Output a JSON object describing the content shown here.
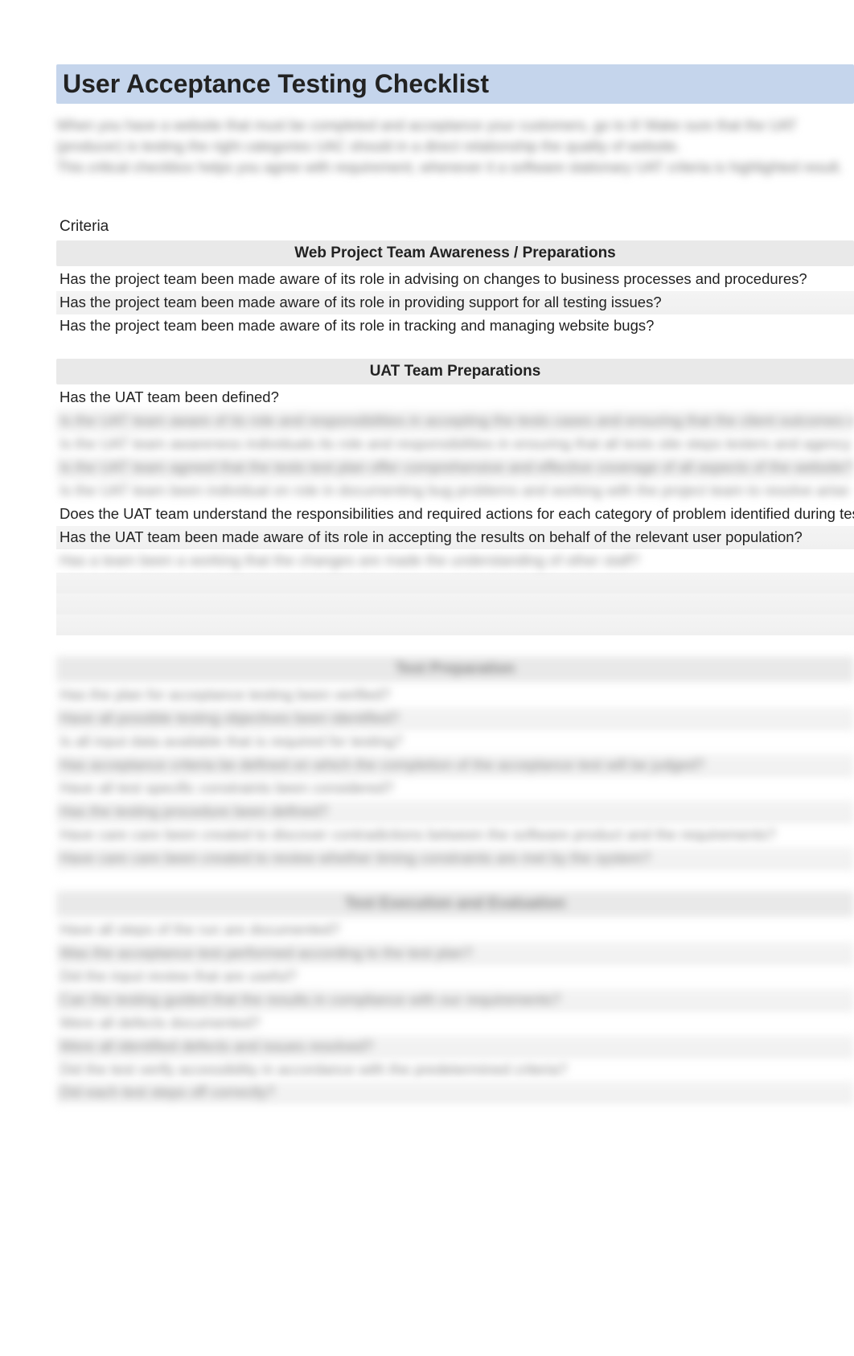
{
  "title": "User Acceptance Testing Checklist",
  "intro_lines": [
    "When you have a website that must be completed and acceptance your customers, go to it! Make sure that the UAT (producer) is testing the right categories UAC should in a direct relationship the quality of website.",
    "This critical checkbox helps you agree with requirement, whenever it a software stationary UAT criteria is highlighted result."
  ],
  "criteria_label": "Criteria",
  "sections": [
    {
      "heading": "Web Project Team Awareness / Preparations",
      "rows": [
        {
          "text": "Has the project team been made aware of its role in advising on changes to business processes and procedures?",
          "blur": false
        },
        {
          "text": "Has the project team been made aware of its role in providing support for all testing issues?",
          "blur": false
        },
        {
          "text": "Has the project team been made aware of its role in tracking and managing website bugs?",
          "blur": false
        }
      ]
    },
    {
      "heading": "UAT Team Preparations",
      "rows": [
        {
          "text": "Has the UAT team been defined?",
          "blur": false
        },
        {
          "text": "Is the UAT team aware of its role and responsibilities in accepting the tests cases and ensuring that the client outcomes within site agreement?",
          "blur": true
        },
        {
          "text": "Is the UAT team awareness individuals its role and responsibilities in ensuring that all tests site steps testers and agency related abilities?",
          "blur": true
        },
        {
          "text": "Is the UAT team agreed that the tests test plan offer comprehensive and effective coverage of all aspects of the website?",
          "blur": true
        },
        {
          "text": "Is the UAT team been individual on role in documenting bug problems and working with the project team to resolve arise during testing?",
          "blur": true
        },
        {
          "text": "Does the UAT team understand the responsibilities and required actions for each category of problem identified during testing?",
          "blur": false
        },
        {
          "text": "Has the UAT team been made aware of its role in accepting the results on behalf of the relevant user population?",
          "blur": false
        },
        {
          "text": "Has a team been a working that the changes are made the understanding of other staff?",
          "blur": true
        },
        {
          "text": " ",
          "blur": false
        },
        {
          "text": " ",
          "blur": false
        },
        {
          "text": " ",
          "blur": false
        }
      ]
    },
    {
      "heading": "Test Preparation",
      "blur_heading": true,
      "rows": [
        {
          "text": "Has the plan for acceptance testing been verified?",
          "blur": true
        },
        {
          "text": "Have all possible testing objectives been identified?",
          "blur": true
        },
        {
          "text": "Is all input data available that is required for testing?",
          "blur": true
        },
        {
          "text": "Has acceptance criteria be defined on which the completion of the acceptance test will be judged?",
          "blur": true
        },
        {
          "text": "Have all test specific constraints been considered?",
          "blur": true
        },
        {
          "text": "Has the testing procedure been defined?",
          "blur": true
        },
        {
          "text": "Have care care been created to discover contradictions between the software product and the requirements?",
          "blur": true
        },
        {
          "text": "Have care care been created to review whether timing constraints are met by the system?",
          "blur": true
        }
      ]
    },
    {
      "heading": "Test Execution and Evaluation",
      "blur_heading": true,
      "rows": [
        {
          "text": "Have all steps of the run are documented?",
          "blur": true
        },
        {
          "text": "Was the acceptance test performed according to the test plan?",
          "blur": true
        },
        {
          "text": "Did the input review that are useful?",
          "blur": true
        },
        {
          "text": "Can the testing guided that the results in compliance with our requirements?",
          "blur": true
        },
        {
          "text": "Were all defects documented?",
          "blur": true
        },
        {
          "text": "Were all identified defects and issues resolved?",
          "blur": true
        },
        {
          "text": "Did the test verify accessibility in accordance with the predetermined criteria?",
          "blur": true
        },
        {
          "text": "Did each test steps off correctly?",
          "blur": true
        }
      ]
    }
  ]
}
